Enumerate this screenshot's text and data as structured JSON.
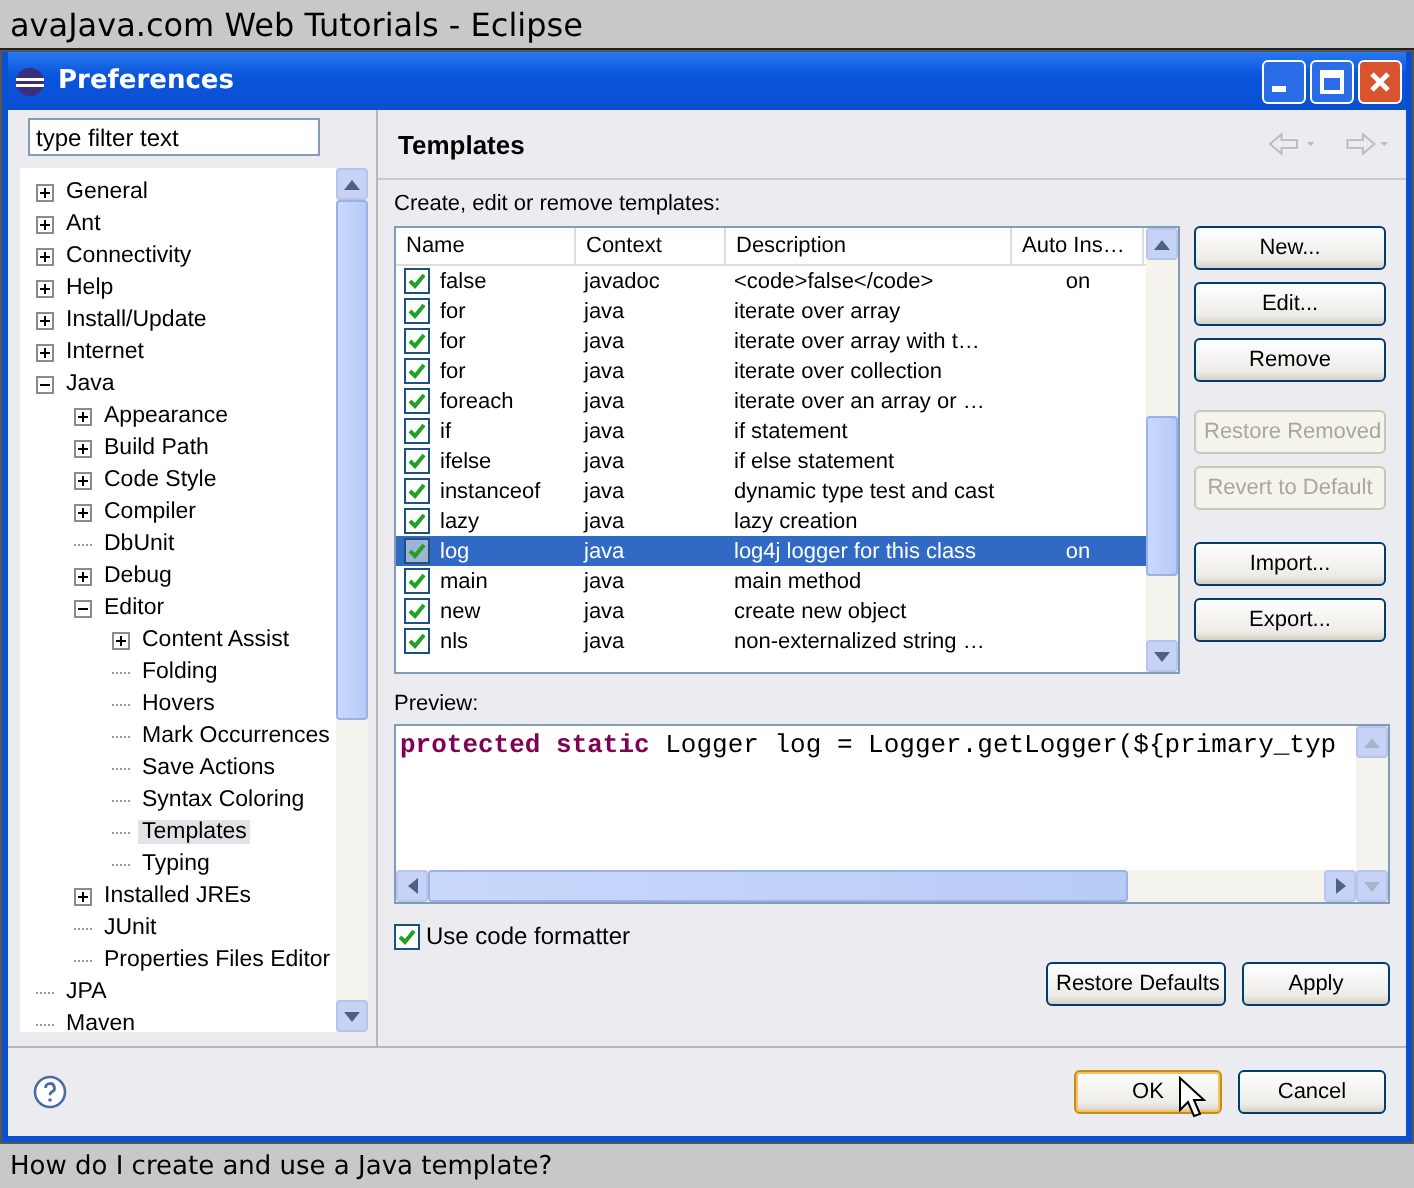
{
  "top_bar": {
    "title": "avaJava.com Web Tutorials - Eclipse"
  },
  "dialog": {
    "title": "Preferences"
  },
  "filter": {
    "value": "type filter text"
  },
  "tree": {
    "items": [
      {
        "label": "General",
        "kind": "folder",
        "expanded": false,
        "selected": false
      },
      {
        "label": "Ant",
        "kind": "folder",
        "expanded": false,
        "selected": false
      },
      {
        "label": "Connectivity",
        "kind": "folder",
        "expanded": false,
        "selected": false
      },
      {
        "label": "Help",
        "kind": "folder",
        "expanded": false,
        "selected": false
      },
      {
        "label": "Install/Update",
        "kind": "folder",
        "expanded": false,
        "selected": false
      },
      {
        "label": "Internet",
        "kind": "folder",
        "expanded": false,
        "selected": false
      },
      {
        "label": "Java",
        "kind": "folder",
        "expanded": true,
        "selected": false,
        "children": [
          {
            "label": "Appearance",
            "kind": "folder",
            "expanded": false,
            "selected": false
          },
          {
            "label": "Build Path",
            "kind": "folder",
            "expanded": false,
            "selected": false
          },
          {
            "label": "Code Style",
            "kind": "folder",
            "expanded": false,
            "selected": false
          },
          {
            "label": "Compiler",
            "kind": "folder",
            "expanded": false,
            "selected": false
          },
          {
            "label": "DbUnit",
            "kind": "leaf",
            "selected": false
          },
          {
            "label": "Debug",
            "kind": "folder",
            "expanded": false,
            "selected": false
          },
          {
            "label": "Editor",
            "kind": "folder",
            "expanded": true,
            "selected": false,
            "children": [
              {
                "label": "Content Assist",
                "kind": "folder",
                "expanded": false,
                "selected": false
              },
              {
                "label": "Folding",
                "kind": "leaf",
                "selected": false
              },
              {
                "label": "Hovers",
                "kind": "leaf",
                "selected": false
              },
              {
                "label": "Mark Occurrences",
                "kind": "leaf",
                "selected": false
              },
              {
                "label": "Save Actions",
                "kind": "leaf",
                "selected": false
              },
              {
                "label": "Syntax Coloring",
                "kind": "leaf",
                "selected": false
              },
              {
                "label": "Templates",
                "kind": "leaf",
                "selected": true
              },
              {
                "label": "Typing",
                "kind": "leaf",
                "selected": false
              }
            ]
          },
          {
            "label": "Installed JREs",
            "kind": "folder",
            "expanded": false,
            "selected": false
          },
          {
            "label": "JUnit",
            "kind": "leaf",
            "selected": false
          },
          {
            "label": "Properties Files Editor",
            "kind": "leaf",
            "selected": false
          }
        ]
      },
      {
        "label": "JPA",
        "kind": "leaf",
        "selected": false
      },
      {
        "label": "Maven",
        "kind": "leaf",
        "selected": false
      }
    ]
  },
  "page": {
    "title": "Templates",
    "description": "Create, edit or remove templates:"
  },
  "table": {
    "columns": [
      "Name",
      "Context",
      "Description",
      "Auto Ins…"
    ],
    "rows": [
      {
        "enabled": true,
        "selected": false,
        "name": "false",
        "context": "javadoc",
        "description": "<code>false</code>",
        "auto_insert": "on"
      },
      {
        "enabled": true,
        "selected": false,
        "name": "for",
        "context": "java",
        "description": "iterate over array"
      },
      {
        "enabled": true,
        "selected": false,
        "name": "for",
        "context": "java",
        "description": "iterate over array with t…"
      },
      {
        "enabled": true,
        "selected": false,
        "name": "for",
        "context": "java",
        "description": "iterate over collection"
      },
      {
        "enabled": true,
        "selected": false,
        "name": "foreach",
        "context": "java",
        "description": "iterate over an array or …"
      },
      {
        "enabled": true,
        "selected": false,
        "name": "if",
        "context": "java",
        "description": "if statement"
      },
      {
        "enabled": true,
        "selected": false,
        "name": "ifelse",
        "context": "java",
        "description": "if else statement"
      },
      {
        "enabled": true,
        "selected": false,
        "name": "instanceof",
        "context": "java",
        "description": "dynamic type test and cast"
      },
      {
        "enabled": true,
        "selected": false,
        "name": "lazy",
        "context": "java",
        "description": "lazy creation"
      },
      {
        "enabled": true,
        "selected": true,
        "name": "log",
        "context": "java",
        "description": "log4j logger for this class",
        "auto_insert": "on"
      },
      {
        "enabled": true,
        "selected": false,
        "name": "main",
        "context": "java",
        "description": "main method"
      },
      {
        "enabled": true,
        "selected": false,
        "name": "new",
        "context": "java",
        "description": "create new object"
      },
      {
        "enabled": true,
        "selected": false,
        "name": "nls",
        "context": "java",
        "description": "non-externalized string …"
      }
    ]
  },
  "side_buttons": [
    {
      "label": "New...",
      "disabled": false
    },
    {
      "label": "Edit...",
      "disabled": false
    },
    {
      "label": "Remove",
      "disabled": false
    },
    {
      "label": "Restore Removed",
      "disabled": true
    },
    {
      "label": "Revert to Default",
      "disabled": true
    },
    {
      "label": "Import...",
      "disabled": false
    },
    {
      "label": "Export...",
      "disabled": false
    }
  ],
  "preview": {
    "label": "Preview:",
    "code": [
      {
        "kind": "keyword",
        "text": "protected static"
      },
      {
        "kind": "plain",
        "text": " Logger log = Logger.getLogger(${primary_typ"
      }
    ]
  },
  "use_formatter": {
    "label": "Use code formatter",
    "checked": true
  },
  "page_buttons": [
    "Restore Defaults",
    "Apply"
  ],
  "dialog_buttons": [
    {
      "label": "OK",
      "default": true
    },
    {
      "label": "Cancel",
      "default": false
    }
  ],
  "caption": "How do I create and use a Java template?"
}
